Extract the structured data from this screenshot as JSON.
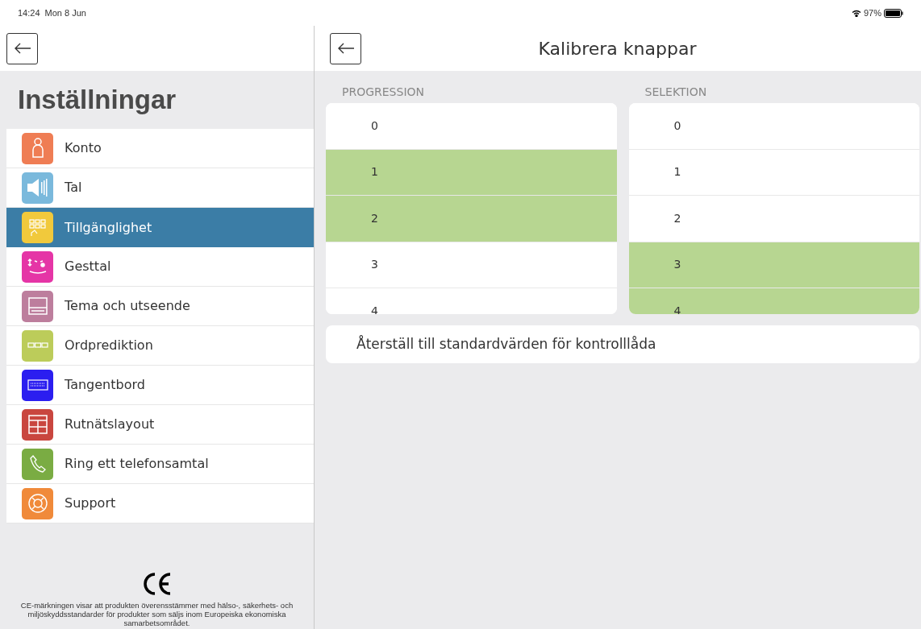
{
  "status_bar": {
    "time": "14:24",
    "date": "Mon 8 Jun",
    "battery_text": "97%"
  },
  "sidebar": {
    "title": "Inställningar",
    "items": [
      {
        "label": "Konto",
        "color": "#ef7d54",
        "selected": false
      },
      {
        "label": "Tal",
        "color": "#7ab9dc",
        "selected": false
      },
      {
        "label": "Tillgänglighet",
        "color": "#f1c93c",
        "selected": true
      },
      {
        "label": "Gesttal",
        "color": "#e535a6",
        "selected": false
      },
      {
        "label": "Tema och utseende",
        "color": "#bd7e9d",
        "selected": false
      },
      {
        "label": "Ordprediktion",
        "color": "#bccc5a",
        "selected": false
      },
      {
        "label": "Tangentbord",
        "color": "#2b1ef0",
        "selected": false
      },
      {
        "label": "Rutnätslayout",
        "color": "#c9463f",
        "selected": false
      },
      {
        "label": "Ring ett telefonsamtal",
        "color": "#7aac43",
        "selected": false
      },
      {
        "label": "Support",
        "color": "#f08a3a",
        "selected": false
      }
    ],
    "footer_text": "CE-märkningen visar att produkten överensstämmer med hälso-, säkerhets- och miljöskyddsstandarder för produkter som säljs inom Europeiska ekonomiska samarbetsområdet."
  },
  "main": {
    "title": "Kalibrera knappar",
    "columns": [
      {
        "heading": "PROGRESSION",
        "options": [
          {
            "label": "0",
            "selected": false
          },
          {
            "label": "1",
            "selected": true
          },
          {
            "label": "2",
            "selected": true
          },
          {
            "label": "3",
            "selected": false
          },
          {
            "label": "4",
            "selected": false
          }
        ]
      },
      {
        "heading": "SELEKTION",
        "options": [
          {
            "label": "0",
            "selected": false
          },
          {
            "label": "1",
            "selected": false
          },
          {
            "label": "2",
            "selected": false
          },
          {
            "label": "3",
            "selected": true
          },
          {
            "label": "4",
            "selected": true
          }
        ]
      }
    ],
    "reset_button": "Återställ till standardvärden för kontrolllåda"
  }
}
